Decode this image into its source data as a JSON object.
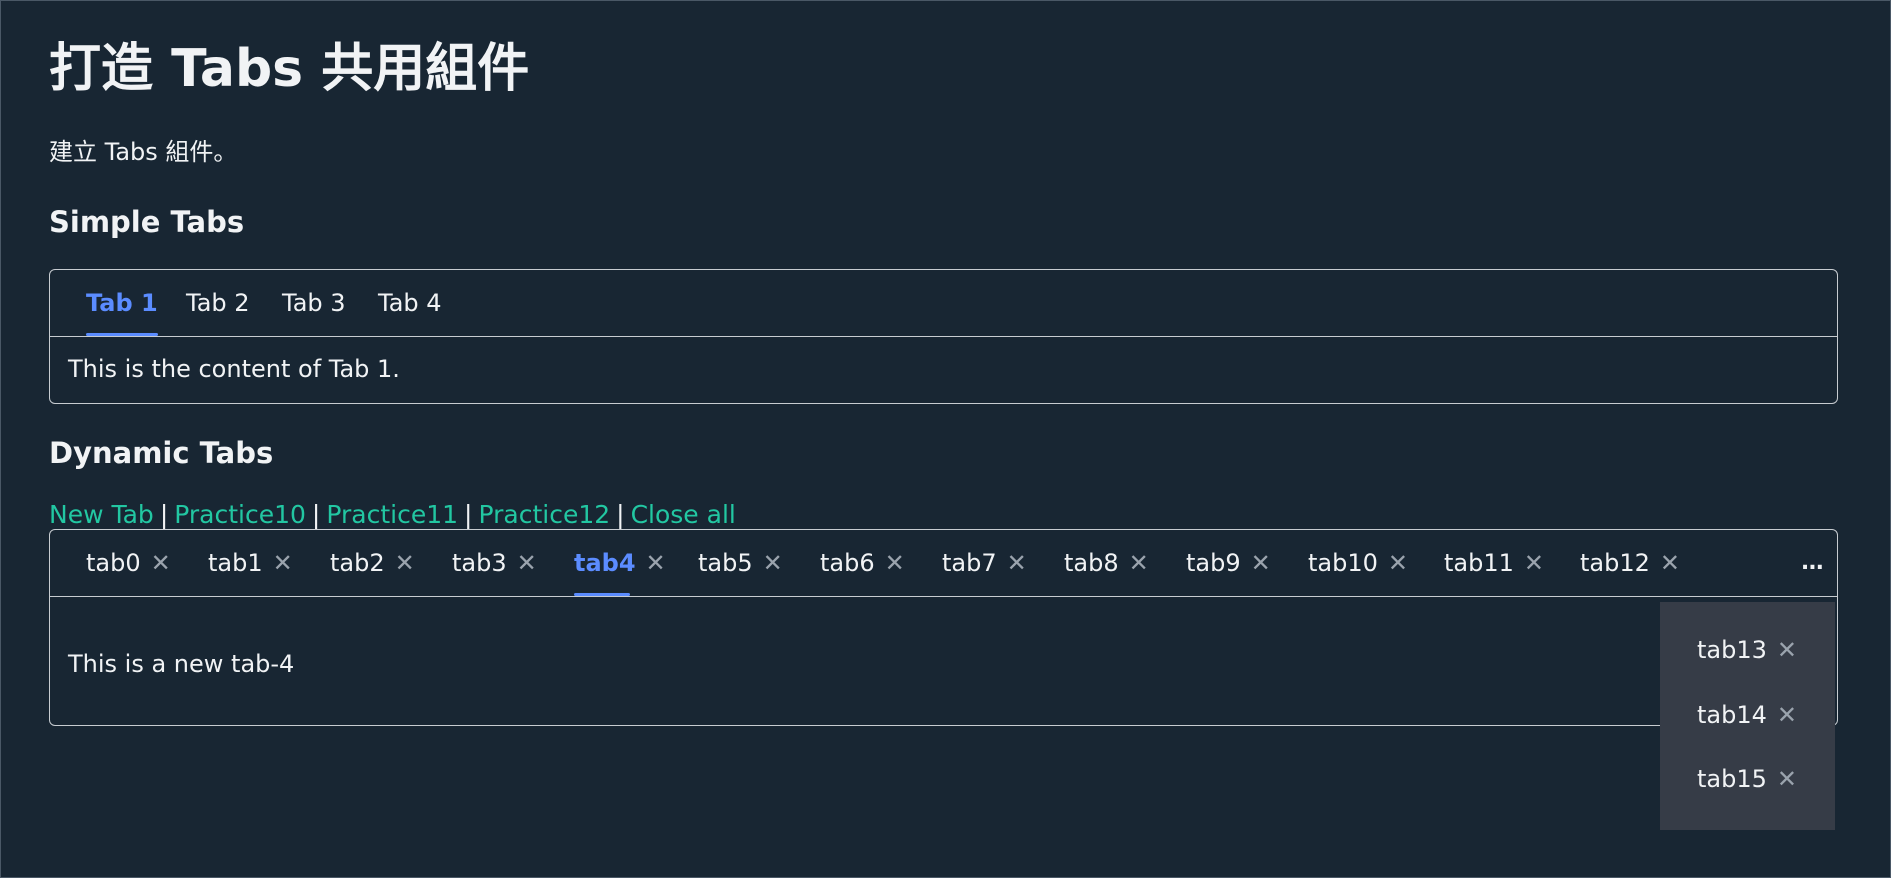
{
  "page": {
    "title": "打造 Tabs 共用組件",
    "intro": "建立 Tabs 組件。"
  },
  "simple_tabs": {
    "heading": "Simple Tabs",
    "tabs": [
      {
        "label": "Tab 1",
        "active": true
      },
      {
        "label": "Tab 2",
        "active": false
      },
      {
        "label": "Tab 3",
        "active": false
      },
      {
        "label": "Tab 4",
        "active": false
      }
    ],
    "content": "This is the content of Tab 1."
  },
  "dynamic_tabs": {
    "heading": "Dynamic Tabs",
    "actions": [
      {
        "label": "New Tab"
      },
      {
        "label": "Practice10"
      },
      {
        "label": "Practice11"
      },
      {
        "label": "Practice12"
      },
      {
        "label": "Close all"
      }
    ],
    "separator": "|",
    "close_glyph": "✕",
    "active_tab": "tab4",
    "tabs": [
      {
        "label": "tab0"
      },
      {
        "label": "tab1"
      },
      {
        "label": "tab2"
      },
      {
        "label": "tab3"
      },
      {
        "label": "tab4"
      },
      {
        "label": "tab5"
      },
      {
        "label": "tab6"
      },
      {
        "label": "tab7"
      },
      {
        "label": "tab8"
      },
      {
        "label": "tab9"
      },
      {
        "label": "tab10"
      },
      {
        "label": "tab11"
      },
      {
        "label": "tab12"
      }
    ],
    "more_label": "...",
    "overflow_tabs": [
      {
        "label": "tab13"
      },
      {
        "label": "tab14"
      },
      {
        "label": "tab15"
      }
    ],
    "content": "This is a new tab-4"
  },
  "colors": {
    "background": "#182633",
    "active_tab": "#5b8cff",
    "link": "#22c7a2",
    "dropdown_bg": "#363c47"
  },
  "icons": {
    "close": "close-icon",
    "more": "ellipsis-icon"
  }
}
